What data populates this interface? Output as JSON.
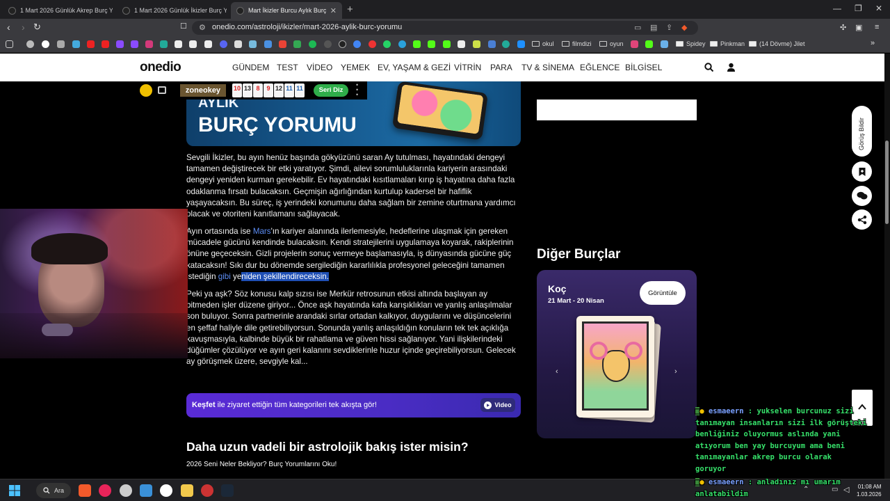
{
  "browser": {
    "tabs": [
      {
        "title": "1 Mart 2026 Günlük Akrep Burç Yoru"
      },
      {
        "title": "1 Mart 2026 Günlük İkizler Burç Yoru"
      },
      {
        "title": "Mart İkizler Burcu Aylık Burç Yo"
      }
    ],
    "url": "onedio.com/astroloji/ikizler/mart-2026-aylik-burc-yorumu",
    "bookmarks": [
      {
        "label": "okul"
      },
      {
        "label": "filmdizi"
      },
      {
        "label": "oyun"
      },
      {
        "label": "Spidey"
      },
      {
        "label": "Pinkman"
      },
      {
        "label": "(14 Dövme) Jilet"
      }
    ]
  },
  "site": {
    "logo": "onedio",
    "nav": [
      "GÜNDEM",
      "TEST",
      "VİDEO",
      "YEMEK",
      "EV, YAŞAM & GEZİ",
      "VİTRİN",
      "PARA",
      "TV & SİNEMA",
      "EĞLENCE",
      "BİLGİSEL"
    ]
  },
  "zone": {
    "logo": "zoneokey",
    "tiles": [
      "10",
      "13",
      "8",
      "9",
      "12",
      "11",
      "11"
    ],
    "button": "Seri Diz"
  },
  "banner": {
    "tag": "AYLIK",
    "title": "BURÇ YORUMU"
  },
  "article": {
    "p1": "Sevgili İkizler, bu ayın henüz başında gökyüzünü saran Ay tutulması, hayatındaki dengeyi tamamen değiştirecek bir etki yaratıyor. Şimdi, ailevi sorumluluklarınla kariyerin arasındaki dengeyi yeniden kurman gerekebilir. Ev hayatındaki kısıtlamaları kırıp iş hayatına daha fazla odaklanma fırsatı bulacaksın. Geçmişin ağırlığından kurtulup kadersel bir hafiflik yaşayacaksın. Bu süreç, iş yerindeki konumunu daha sağlam bir zemine oturtmana yardımcı olacak ve otoriteni kanıtlamanı sağlayacak.",
    "p2_a": "Ayın ortasında ise ",
    "p2_link": "Mars",
    "p2_b": "'ın kariyer alanında ilerlemesiyle, hedeflerine ulaşmak için gereken mücadele gücünü kendinde bulacaksın. Kendi stratejilerini uygulamaya koyarak, rakiplerinin önüne geçeceksin. Gizli projelerin sonuç vermeye başlamasıyla, iş dünyasında gücüne güç katacaksın! Sıkı dur bu dönemde sergilediğin kararlılıkla profesyonel geleceğini tamamen istediğin ",
    "p2_link2": "gibi",
    "p2_c": " ye",
    "p2_hl": "niden şekillendireceksin.",
    "p3": "Peki ya aşk? Söz konusu kalp sızısı ise Merkür retrosunun etkisi altında başlayan ay bitmeden işler düzene giriyor... Önce aşk hayatında kafa karışıklıkları ve yanlış anlaşılmalar son buluyor. Sonra partnerinle arandaki sırlar ortadan kalkıyor, duygularını ve düşüncelerini en şeffaf haliyle dile getirebiliyorsun. Sonunda yanlış anlaşıldığın konuların tek tek açıklığa kavuşmasıyla, kalbinde büyük bir rahatlama ve güven hissi sağlanıyor. Yani ilişkilerindeki düğümler çözülüyor ve ayın geri kalanını sevdiklerinle huzur içinde geçirebiliyorsun. Gelecek ay görüşmek üzere, sevgiyle kal...",
    "explore_bold": "Keşfet",
    "explore_rest": " ile ziyaret ettiğin tüm kategorileri tek akışta gör!",
    "video_label": "Video",
    "heading": "Daha uzun vadeli bir astrolojik bakış ister misin?",
    "subheading": "2026 Seni Neler Bekliyor? Burç Yorumlarını Oku!"
  },
  "sidebar": {
    "other_heading": "Diğer Burçlar",
    "sign_name": "Koç",
    "sign_dates": "21 Mart - 20 Nisan",
    "view_label": "Görüntüle",
    "feedback_label": "Görüş Bildir"
  },
  "chat": [
    {
      "user": "esmaeern",
      "line1": "yukselen burcunuz sizi",
      "line2": "tanımayan insanların sizi ilk görüşteki",
      "line3": "benliğiniz oluyormus aslında yani",
      "line4": "atıyorum ben yay burcuyum ama beni",
      "line5": "tanımayanlar akrep burcu olarak",
      "line6": "goruyor"
    },
    {
      "user": "esmaeern",
      "line1": "anladınız mı umarım",
      "line2": "anlatabildim"
    }
  ],
  "taskbar": {
    "search": "Ara",
    "time": "01:08 AM",
    "date": "1.03.2026"
  }
}
